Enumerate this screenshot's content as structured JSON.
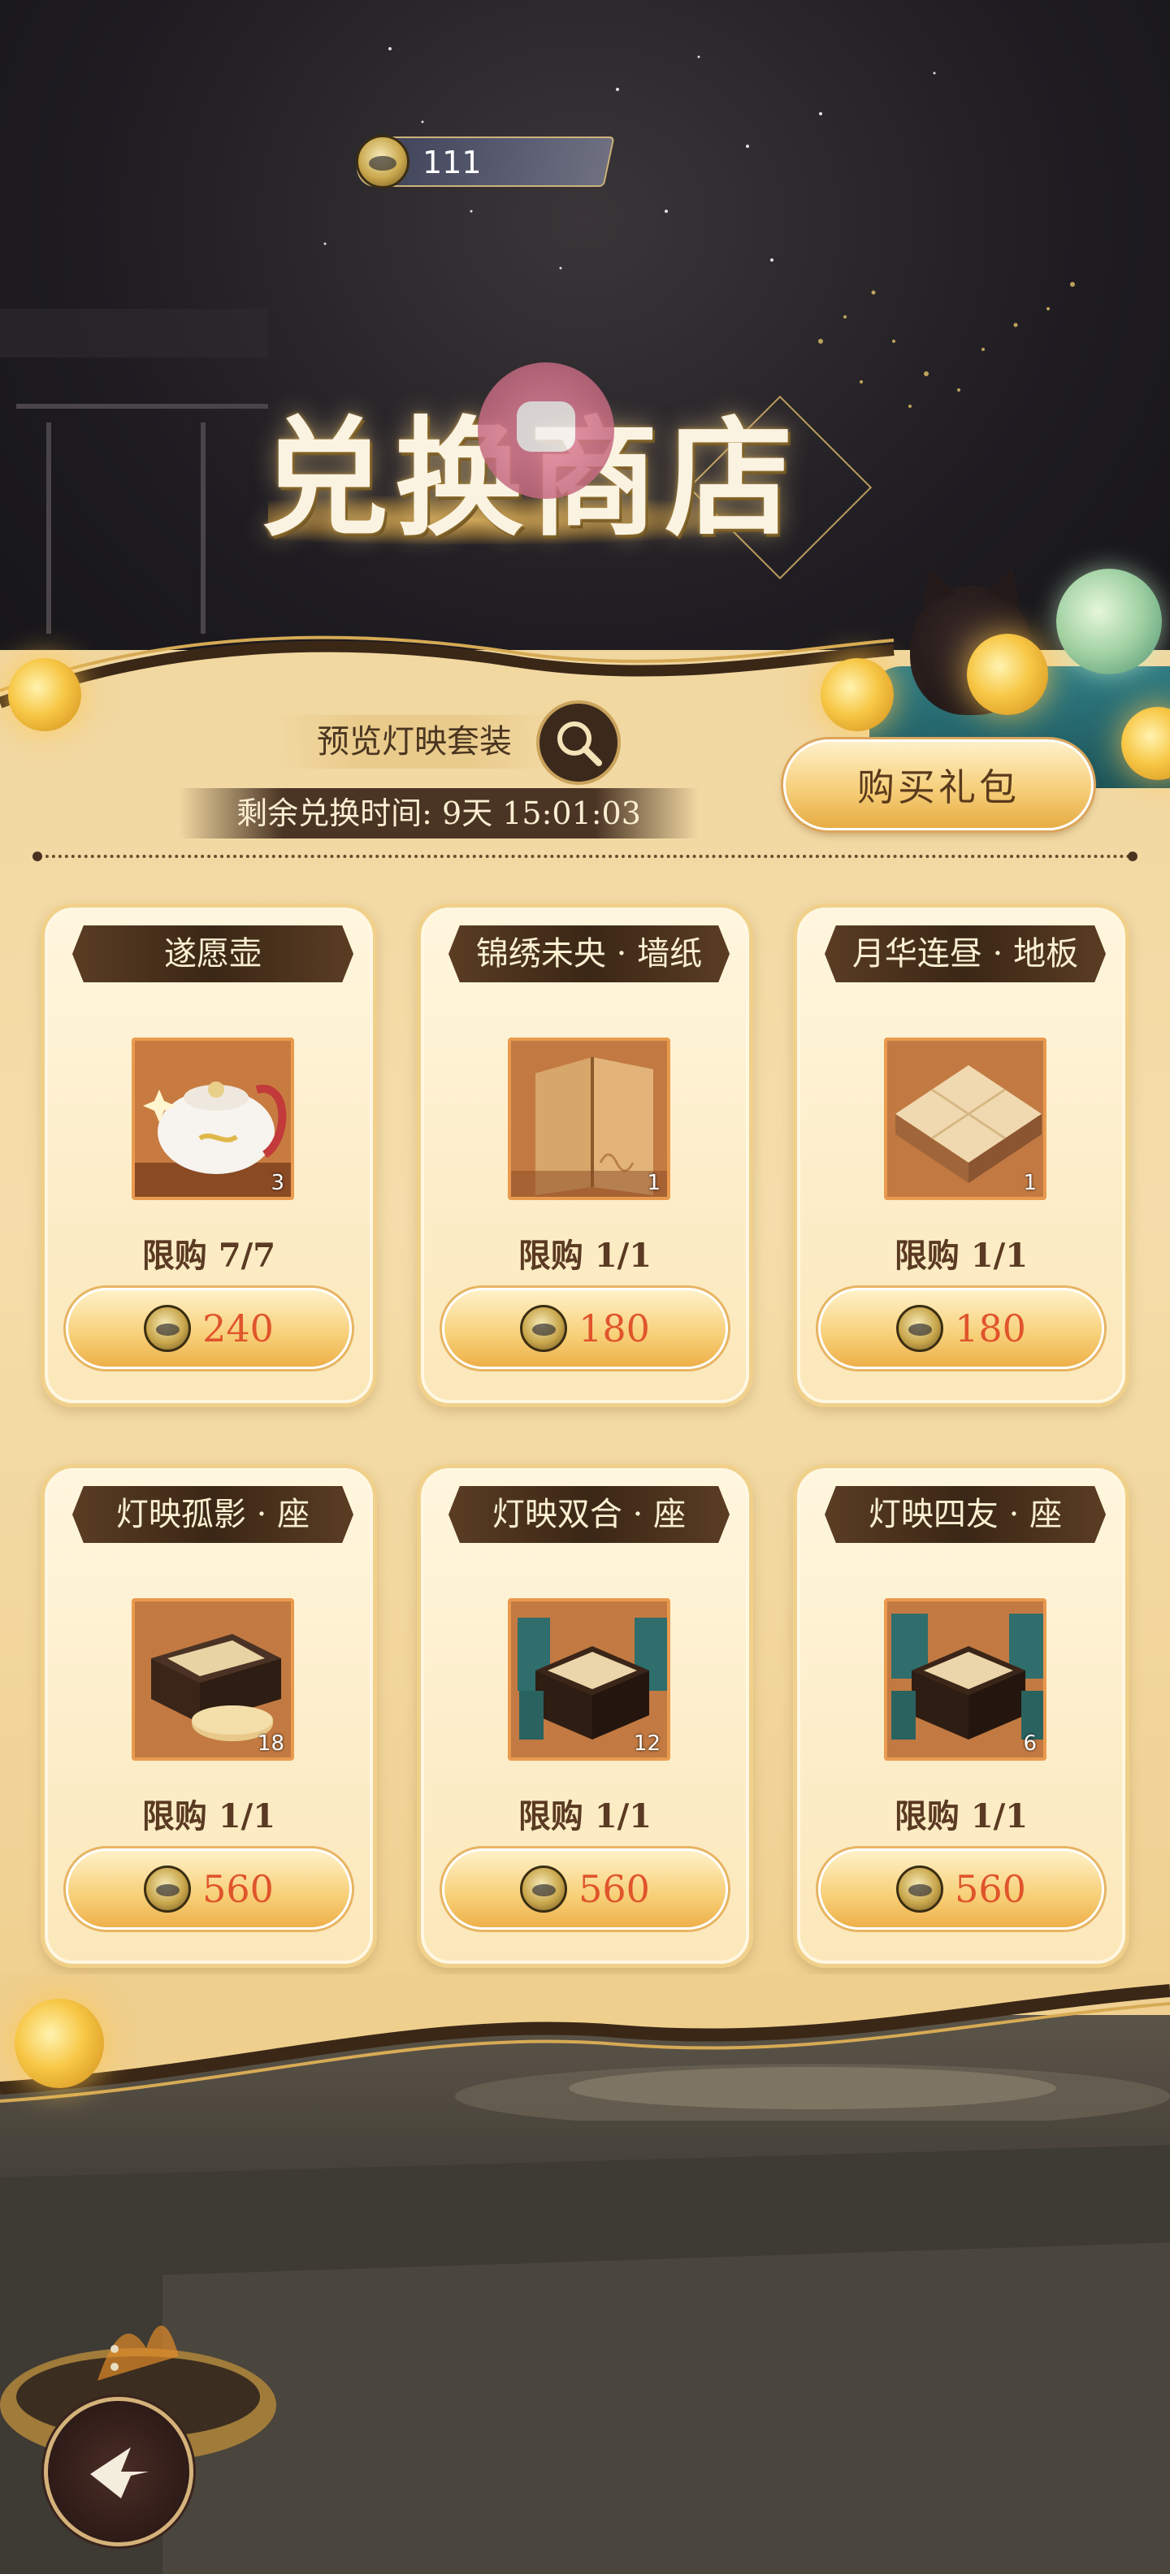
{
  "currency": {
    "amount": "111",
    "icon": "lantern-coin-icon"
  },
  "title": "兑换商店",
  "preview": {
    "label": "预览灯映套装",
    "icon": "magnifier-icon"
  },
  "timer": {
    "text": "剩余兑换时间: 9天 15:01:03"
  },
  "buy_pack": {
    "label": "购买礼包"
  },
  "items": [
    {
      "name": "遂愿壶",
      "count": "3",
      "limit": "限购 7/7",
      "price": "240",
      "art": "teapot"
    },
    {
      "name": "锦绣未央 · 墙纸",
      "count": "1",
      "limit": "限购 1/1",
      "price": "180",
      "art": "wallpaper"
    },
    {
      "name": "月华连昼 · 地板",
      "count": "1",
      "limit": "限购 1/1",
      "price": "180",
      "art": "floor"
    },
    {
      "name": "灯映孤影 · 座",
      "count": "18",
      "limit": "限购 1/1",
      "price": "560",
      "art": "table-single"
    },
    {
      "name": "灯映双合 · 座",
      "count": "12",
      "limit": "限购 1/1",
      "price": "560",
      "art": "table-double"
    },
    {
      "name": "灯映四友 · 座",
      "count": "6",
      "limit": "限购 1/1",
      "price": "560",
      "art": "table-four"
    }
  ],
  "back": {
    "icon": "back-arrow-icon"
  },
  "colors": {
    "accent": "#f6cf7a",
    "price": "#e0542c",
    "dark": "#3b2716"
  }
}
